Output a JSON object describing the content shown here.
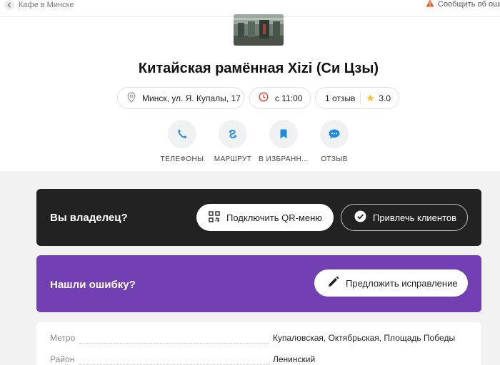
{
  "topbar": {
    "back_label": "Кафе в Минске",
    "report_label": "Сообщить об оши"
  },
  "place": {
    "title": "Китайская рамённая Xizi (Си Цзы)",
    "address": "Минск, ул. Я. Купалы, 17",
    "hours": "с 11:00",
    "reviews": "1 отзыв",
    "rating": "3.0"
  },
  "actions": [
    {
      "label": "ТЕЛЕФОНЫ",
      "icon": "phone-icon"
    },
    {
      "label": "МАРШРУТ",
      "icon": "route-icon"
    },
    {
      "label": "В ИЗБРАНН...",
      "icon": "bookmark-icon"
    },
    {
      "label": "ОТЗЫВ",
      "icon": "chat-icon"
    }
  ],
  "owner": {
    "question": "Вы владелец?",
    "qr_button": "Подключить QR-меню",
    "clients_button": "Привлечь клиентов"
  },
  "error": {
    "question": "Нашли ошибку?",
    "fix_button": "Предложить исправление"
  },
  "info": [
    {
      "key": "Метро",
      "value": "Купаловская, Октябрьская, Площадь Победы"
    },
    {
      "key": "Район",
      "value": "Ленинский"
    }
  ],
  "colors": {
    "accent_blue": "#1e8be0",
    "owner_bg": "#222222",
    "error_bg": "#7240b3",
    "warning": "#e8581f",
    "clock": "#e03c31",
    "star": "#f3c531"
  }
}
